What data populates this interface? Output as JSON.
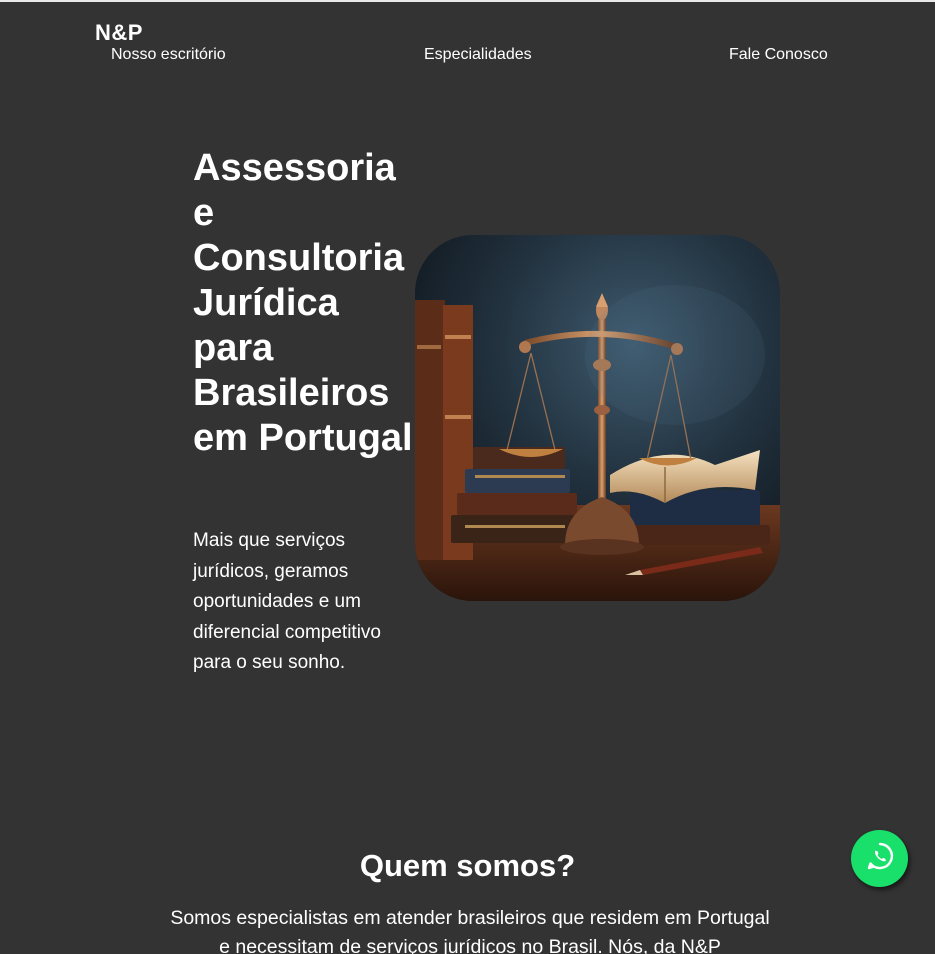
{
  "header": {
    "logo": "N&P",
    "nav": [
      {
        "label": "Nosso escritório"
      },
      {
        "label": "Especialidades"
      },
      {
        "label": "Fale Conosco"
      }
    ]
  },
  "hero": {
    "title": "Assessoria e Consultoria Jurídica para Brasileiros em Portugal",
    "subtitle": "Mais que serviços jurídicos, geramos oportunidades e um diferencial competitivo para o seu sonho.",
    "image_icon": "scales-of-justice-image"
  },
  "about": {
    "title": "Quem somos?",
    "text": "Somos especialistas em atender brasileiros que residem em Portugal e necessitam de serviços jurídicos no Brasil. Nós, da N&P"
  },
  "floating": {
    "whatsapp_icon": "whatsapp-icon",
    "whatsapp_color": "#19e06b"
  },
  "colors": {
    "background": "#333333",
    "text": "#ffffff"
  }
}
